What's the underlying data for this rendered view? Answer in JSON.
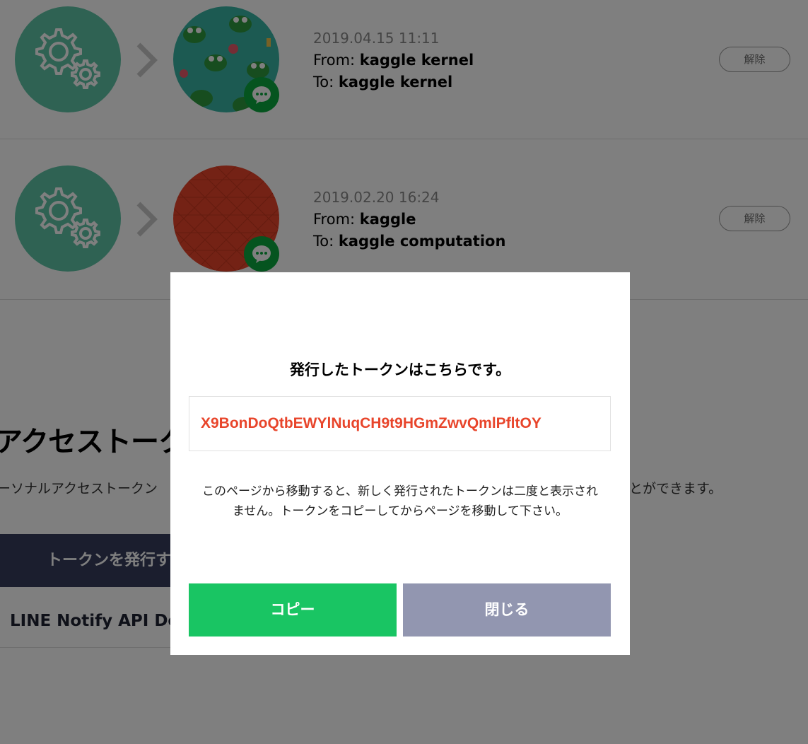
{
  "connections": [
    {
      "date": "2019.04.15 11:11",
      "from_label": "From:",
      "from_value": "kaggle kernel",
      "to_label": "To:",
      "to_value": "kaggle kernel",
      "release_label": "解除"
    },
    {
      "date": "2019.02.20 16:24",
      "from_label": "From:",
      "from_value": "kaggle",
      "to_label": "To:",
      "to_value": "kaggle computation",
      "release_label": "解除"
    }
  ],
  "section": {
    "title": "アクセストーク",
    "desc_left": "ーソナルアクセストークン",
    "desc_right": "とができます。",
    "issue_button_label": "トークンを発行す",
    "doc_link_label": "LINE Notify API Doc"
  },
  "modal": {
    "title": "発行したトークンはこちらです。",
    "token": "X9BonDoQtbEWYlNuqCH9t9HGmZwvQmlPfltOY",
    "note_line1": "このページから移動すると、新しく発行されたトークンは二度と表示され",
    "note_line2": "ません。トークンをコピーしてからページを移動して下さい。",
    "copy_label": "コピー",
    "close_label": "閉じる"
  },
  "colors": {
    "service_circle": "#5fc4a6",
    "chat_badge": "#0aa83e",
    "token_text": "#e8452b",
    "copy_button": "#19c563",
    "close_button": "#9296b0",
    "issue_button": "#363d5c"
  },
  "icons": {
    "service": "gears-icon",
    "arrow": "chevron-right-icon",
    "badge": "chat-bubble-icon"
  }
}
